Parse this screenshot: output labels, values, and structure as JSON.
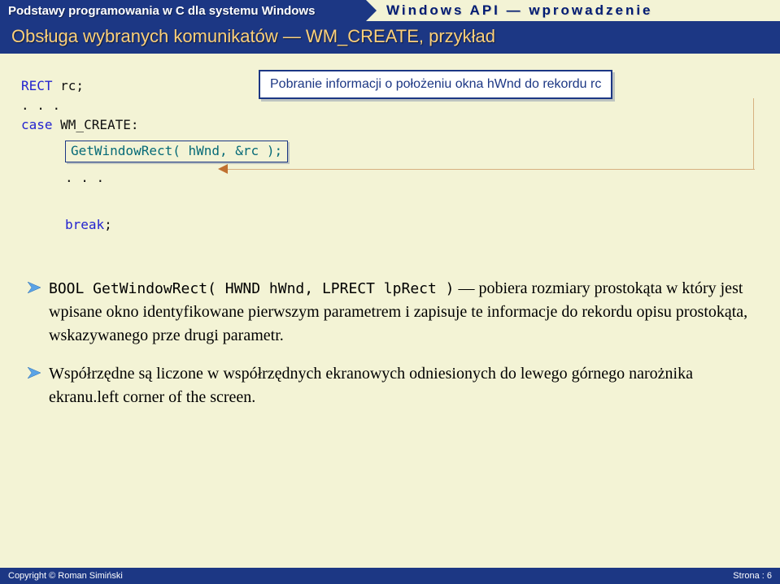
{
  "header": {
    "left": "Podstawy programowania w C dla systemu Windows",
    "right": "Windows API — wprowadzenie"
  },
  "subtitle": "Obsługa wybranych komunikatów — WM_CREATE, przykład",
  "annotation": "Pobranie informacji o położeniu okna hWnd do rekordu rc",
  "code": {
    "l1a": "RECT",
    "l1b": " rc;",
    "l2": ". . .",
    "l3a": "case",
    "l3b": " WM_CREATE:",
    "l4": "GetWindowRect( hWnd, &rc );",
    "l5": ". . .",
    "l6a": "break",
    "l6b": ";"
  },
  "bullets": {
    "b1_sig": "BOOL GetWindowRect( HWND hWnd,  LPRECT lpRect )",
    "b1_rest": " — pobiera rozmiary prostokąta w który jest wpisane okno identyfikowane  pierwszym parametrem i zapisuje te informacje do rekordu opisu prostokąta, wskazywanego prze drugi parametr.",
    "b2": "Współrzędne są liczone w współrzędnych ekranowych  odniesionych do lewego górnego narożnika ekranu.left corner of the screen."
  },
  "footer": {
    "left": "Copyright © Roman Simiński",
    "right": "Strona : 6"
  }
}
